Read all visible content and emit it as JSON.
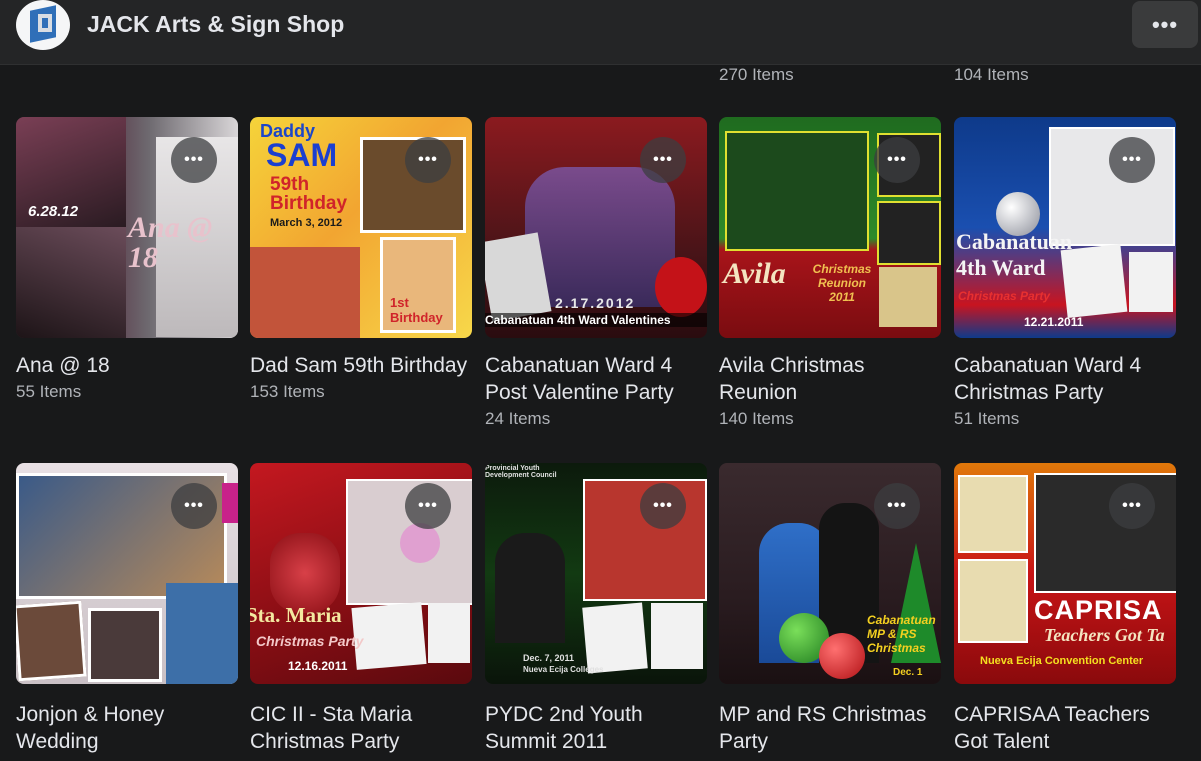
{
  "header": {
    "title": "JACK Arts & Sign Shop",
    "more_icon": "•••"
  },
  "previous_row_counts": [
    "270 Items",
    "104 Items"
  ],
  "albums": [
    {
      "title": "Ana @ 18",
      "count": "55 Items",
      "overlay": "Ana @ 18",
      "date": "6.28.12"
    },
    {
      "title": "Dad Sam 59th Birthday",
      "count": "153 Items",
      "overlay_top": "Daddy",
      "overlay_main": "SAM",
      "overlay_sub": "59th Birthday",
      "overlay_date": "March 3, 2012",
      "overlay_corner": "1st Birthday"
    },
    {
      "title": "Cabanatuan Ward 4 Post Valentine Party",
      "count": "24 Items",
      "overlay_date": "2.17.2012",
      "overlay_caption": "Cabanatuan 4th Ward Valentines"
    },
    {
      "title": "Avila Christmas Reunion",
      "count": "140 Items",
      "overlay_main": "Avila",
      "overlay_sub": "Christmas Reunion 2011"
    },
    {
      "title": "Cabanatuan Ward 4 Christmas Party",
      "count": "51 Items",
      "overlay_main": "Cabanatuan 4th Ward",
      "overlay_sub": "Christmas Party",
      "overlay_date": "12.21.2011"
    },
    {
      "title": "Jonjon & Honey Wedding",
      "count": ""
    },
    {
      "title": "CIC II - Sta Maria Christmas Party",
      "count": "",
      "overlay_main": "Sta. Maria",
      "overlay_sub": "Christmas Party",
      "overlay_date": "12.16.2011"
    },
    {
      "title": "PYDC 2nd Youth Summit 2011",
      "count": "",
      "overlay_top": "Provincial Youth Development Council",
      "overlay_date": "Dec. 7, 2011",
      "overlay_caption": "Nueva Ecija Colleges"
    },
    {
      "title": "MP and RS Christmas Party",
      "count": "",
      "overlay_main": "Cabanatuan MP & RS Christmas",
      "overlay_date": "Dec. 1"
    },
    {
      "title": "CAPRISAA Teachers Got Talent",
      "count": "",
      "overlay_main": "CAPRISA",
      "overlay_sub": "Teachers Got Ta",
      "overlay_caption": "Nueva Ecija Convention Center"
    }
  ],
  "album_more_icon": "•••"
}
